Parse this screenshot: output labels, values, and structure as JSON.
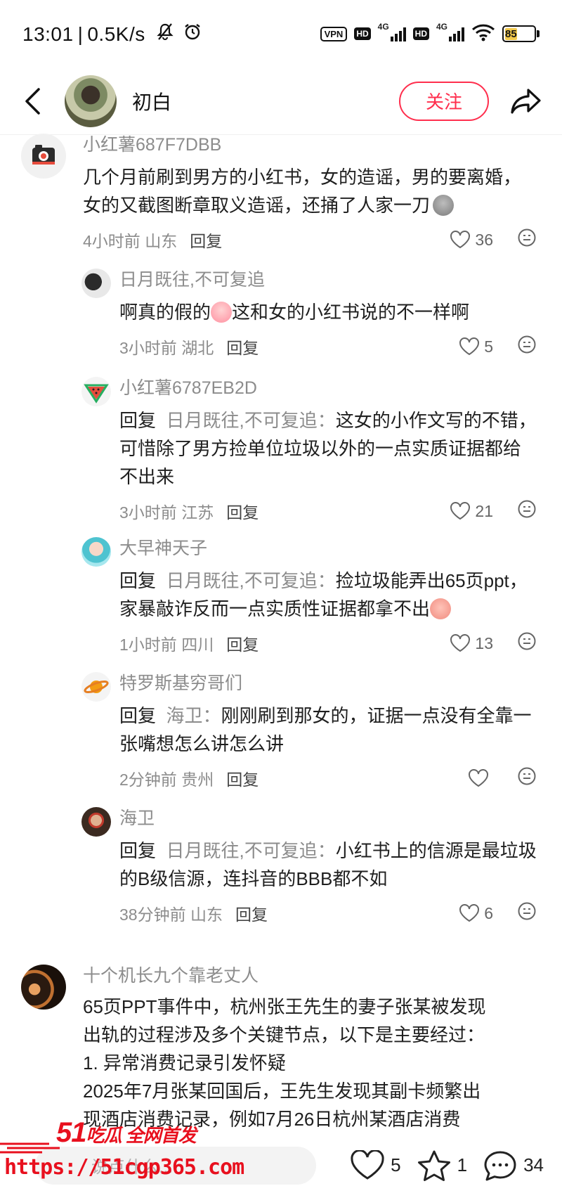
{
  "status_bar": {
    "time": "13:01",
    "speed": "0.5K/s",
    "vpn": "VPN",
    "hd": "HD",
    "net1": "4G",
    "net2": "4G",
    "battery": "85"
  },
  "nav": {
    "username": "初白",
    "follow_label": "关注"
  },
  "comments": [
    {
      "author": "小红薯687F7DBB",
      "text": "几个月前刷到男方的小红书，女的造谣，男的要离婚，女的又截图断章取义造谣，还捅了人家一刀",
      "time": "4小时前",
      "location": "山东",
      "reply_label": "回复",
      "likes": "36",
      "avatar_icon": "camera-avatar-icon"
    },
    {
      "author": "日月既往,不可复追",
      "text": "啊真的假的",
      "text_tail": "这和女的小红书说的不一样啊",
      "time": "3小时前",
      "location": "湖北",
      "reply_label": "回复",
      "likes": "5"
    },
    {
      "author": "小红薯6787EB2D",
      "prefix": "回复",
      "target": "日月既往,不可复追：",
      "text": "这女的小作文写的不错，可惜除了男方捡单位垃圾以外的一点实质证据都给不出来",
      "time": "3小时前",
      "location": "江苏",
      "reply_label": "回复",
      "likes": "21",
      "avatar_icon": "watermelon-avatar-icon"
    },
    {
      "author": "大早神天子",
      "prefix": "回复",
      "target": "日月既往,不可复追：",
      "text": "捡垃圾能弄出65页ppt，家暴敲诈反而一点实质性证据都拿不出",
      "time": "1小时前",
      "location": "四川",
      "reply_label": "回复",
      "likes": "13"
    },
    {
      "author": "特罗斯基穷哥们",
      "prefix": "回复",
      "target": "海卫：",
      "text": "刚刚刷到那女的，证据一点没有全靠一张嘴想怎么讲怎么讲",
      "time": "2分钟前",
      "location": "贵州",
      "reply_label": "回复",
      "likes": "",
      "avatar_icon": "planet-avatar-icon"
    },
    {
      "author": "海卫",
      "prefix": "回复",
      "target": "日月既往,不可复追：",
      "text": "小红书上的信源是最垃圾的B级信源，连抖音的BBB都不如",
      "time": "38分钟前",
      "location": "山东",
      "reply_label": "回复",
      "likes": "6"
    },
    {
      "author": "十个机长九个靠老丈人",
      "text_lines": [
        "65页PPT事件中，杭州张王先生的妻子张某被发现",
        "出轨的过程涉及多个关键节点，以下是主要经过：",
        "1. 异常消费记录引发怀疑",
        "2025年7月张某回国后，王先生发现其副卡频繁出",
        "现酒店消费记录，例如7月26日杭州某酒店消费"
      ]
    }
  ],
  "watermark": {
    "logo_num": "51",
    "logo_text": "吃瓜 全网首发",
    "url": "https://51cgp365.com"
  },
  "bottom_bar": {
    "input_placeholder": "说点什么...",
    "likes": "5",
    "stars": "1",
    "comments": "34"
  }
}
